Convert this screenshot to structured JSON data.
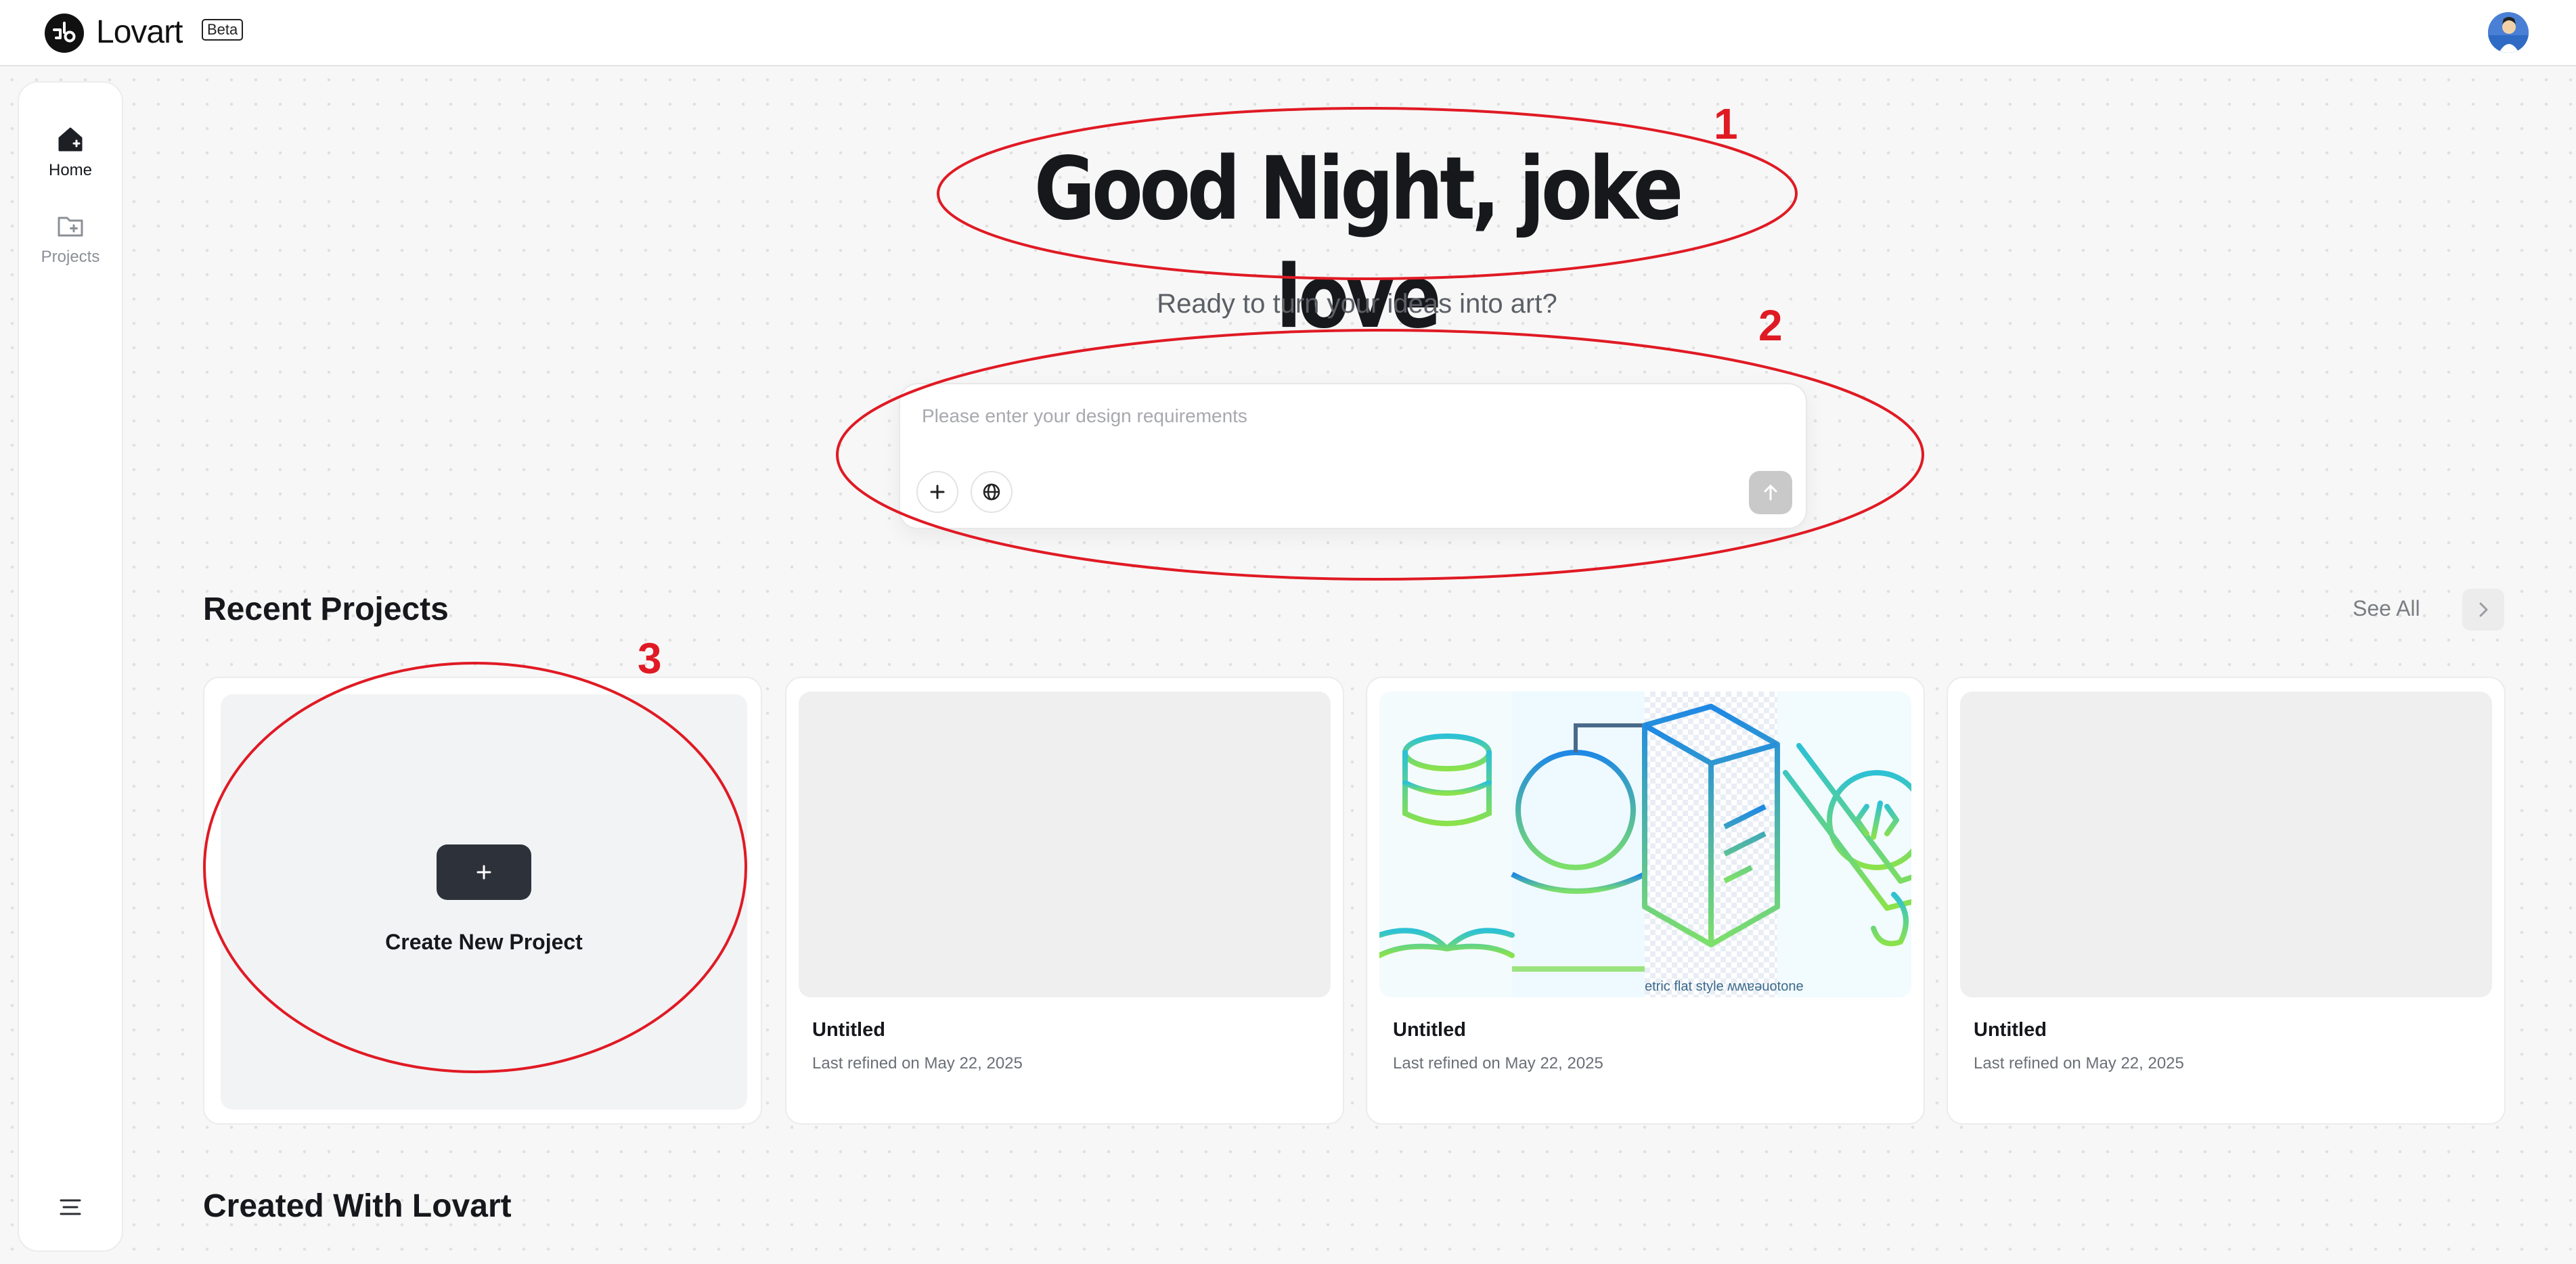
{
  "app": {
    "name": "Lovart",
    "badge": "Beta"
  },
  "sidebar": {
    "items": [
      {
        "label": "Home",
        "icon": "home-icon",
        "active": true
      },
      {
        "label": "Projects",
        "icon": "folder-plus-icon",
        "active": false
      }
    ],
    "menu_icon": "menu-icon"
  },
  "hero": {
    "greeting": "Good Night, joke love",
    "subtitle": "Ready to turn your ideas into art?"
  },
  "prompt": {
    "placeholder": "Please enter your design requirements",
    "value": "",
    "buttons": [
      "plus-icon",
      "globe-icon"
    ],
    "send_icon": "arrow-up-icon"
  },
  "recent_projects": {
    "title": "Recent Projects",
    "see_all": "See All",
    "create_label": "Create New Project",
    "cards": [
      {
        "title": "Untitled",
        "subtitle": "Last refined on May 22, 2025"
      },
      {
        "title": "Untitled",
        "subtitle": "Last refined on May 22, 2025",
        "thumb_caption": "etric flat style ʍʍɐǝuotone"
      },
      {
        "title": "Untitled",
        "subtitle": "Last refined on May 22, 2025"
      }
    ]
  },
  "created_with": {
    "title": "Created With Lovart"
  },
  "annotations": [
    {
      "label": "1"
    },
    {
      "label": "2"
    },
    {
      "label": "3"
    }
  ],
  "colors": {
    "annotation": "#e01a24",
    "accent_dark": "#2d323a",
    "background": "#f7f7f7"
  }
}
